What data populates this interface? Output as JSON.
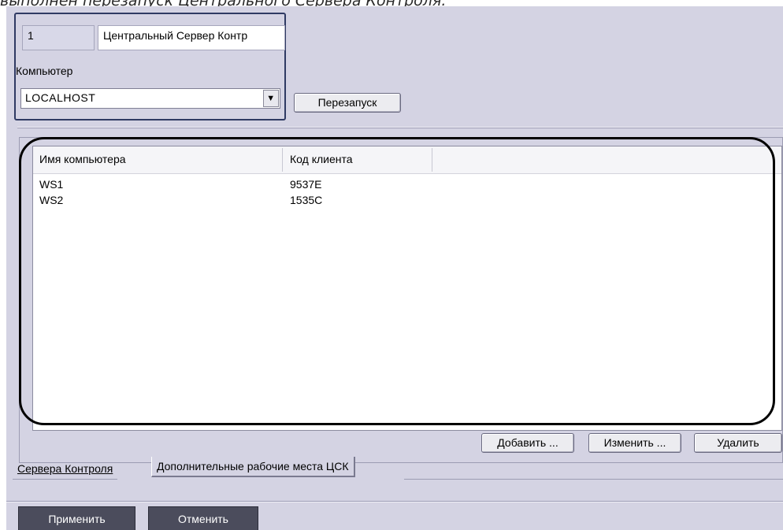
{
  "caption": "выполнен перезапуск Центрального Сервера Контроля.",
  "object": {
    "id": "1",
    "name": "Центральный Сервер Контр",
    "computer_label": "Компьютер",
    "computer_value": "LOCALHOST"
  },
  "restart_button": "Перезапуск",
  "table": {
    "columns": [
      "Имя компьютера",
      "Код клиента"
    ],
    "rows": [
      [
        "WS1",
        "9537E"
      ],
      [
        "WS2",
        "1535C"
      ]
    ]
  },
  "actions": {
    "add": "Добавить ...",
    "edit": "Изменить ...",
    "delete": "Удалить"
  },
  "tabs": [
    "Сервера Контроля",
    "Дополнительные рабочие места ЦСК"
  ],
  "active_tab": "Дополнительные рабочие места ЦСК",
  "footer": {
    "apply": "Применить",
    "cancel": "Отменить"
  }
}
